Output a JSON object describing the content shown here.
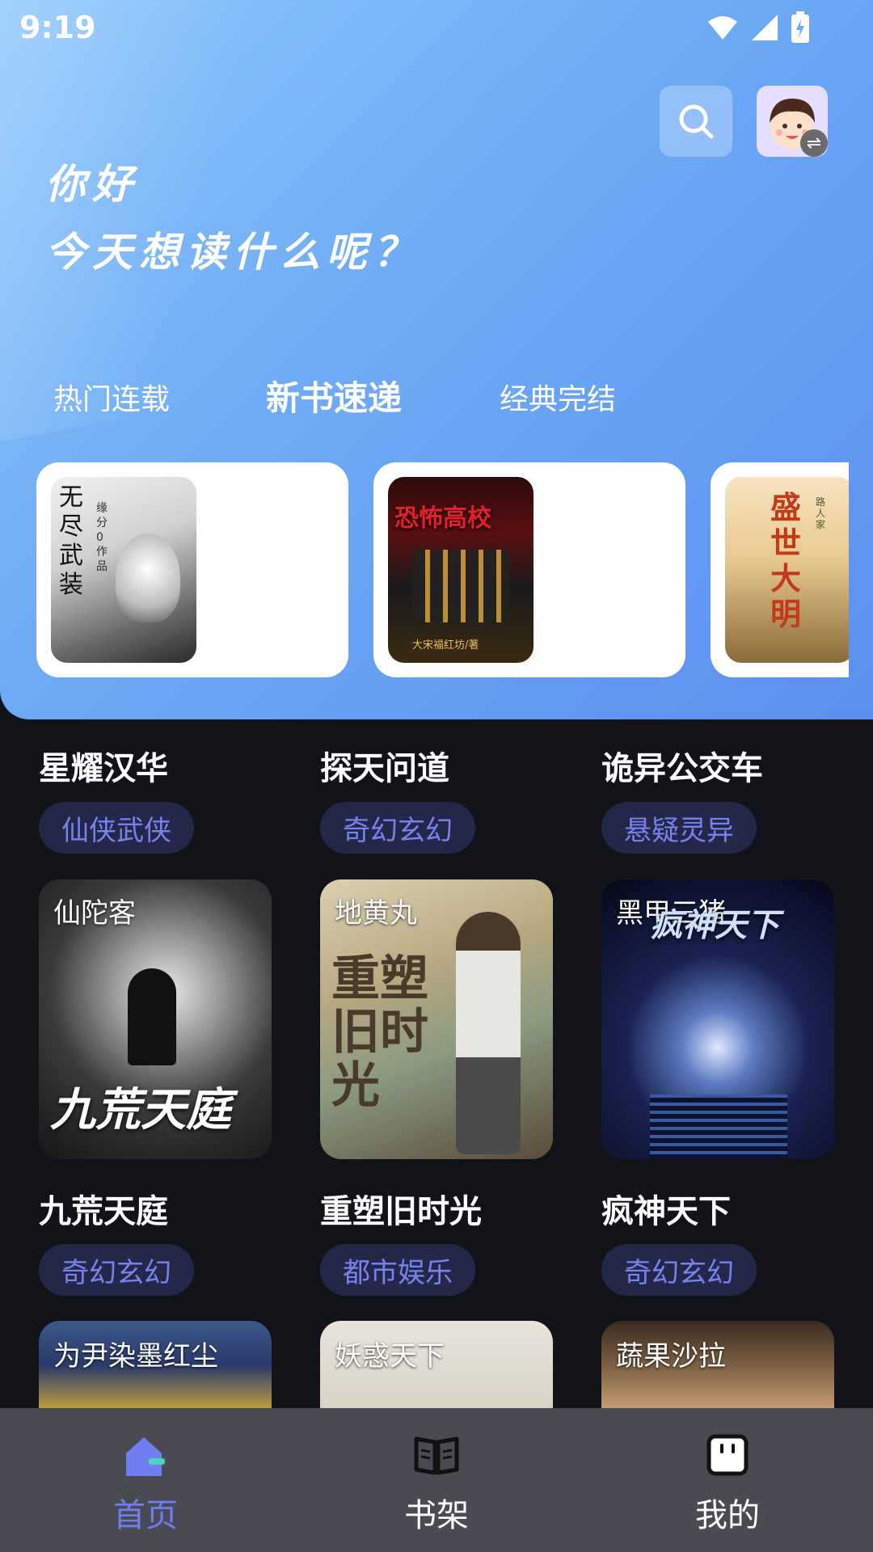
{
  "status": {
    "time": "9:19"
  },
  "header": {
    "greeting": "你好",
    "subtitle": "今天想读什么呢？"
  },
  "tabs": [
    {
      "label": "热门连载",
      "active": false
    },
    {
      "label": "新书速递",
      "active": true
    },
    {
      "label": "经典完结",
      "active": false
    }
  ],
  "featured": [
    {
      "cover_text": "无尽武装",
      "cover_sub": "缘分0 作品"
    },
    {
      "cover_text": "恐怖高校",
      "cover_sub": "大宋福红坊/著"
    },
    {
      "cover_text": "盛世大明",
      "cover_sub": "路人家"
    }
  ],
  "top_row": [
    {
      "title": "星耀汉华",
      "tag": "仙侠武侠"
    },
    {
      "title": "探天问道",
      "tag": "奇幻玄幻"
    },
    {
      "title": "诡异公交车",
      "tag": "悬疑灵异"
    }
  ],
  "books": [
    {
      "author": "仙陀客",
      "cover_title": "九荒天庭",
      "title": "九荒天庭",
      "tag": "奇幻玄幻"
    },
    {
      "author": "地黄丸",
      "cover_title": "重塑旧时光",
      "title": "重塑旧时光",
      "tag": "都市娱乐"
    },
    {
      "author": "黑甲三猪",
      "cover_title": "疯神天下",
      "title": "疯神天下",
      "tag": "奇幻玄幻"
    }
  ],
  "bottom_row": [
    {
      "author": "为尹染墨红尘"
    },
    {
      "author": "妖惑天下"
    },
    {
      "author": "蔬果沙拉"
    }
  ],
  "nav": [
    {
      "label": "首页",
      "icon": "home-icon",
      "active": true
    },
    {
      "label": "书架",
      "icon": "bookshelf-icon",
      "active": false
    },
    {
      "label": "我的",
      "icon": "profile-icon",
      "active": false
    }
  ],
  "colors": {
    "accent": "#6f7ef0",
    "tag_bg": "#242848",
    "page_bg": "#121318",
    "nav_bg": "#4a4b52"
  }
}
